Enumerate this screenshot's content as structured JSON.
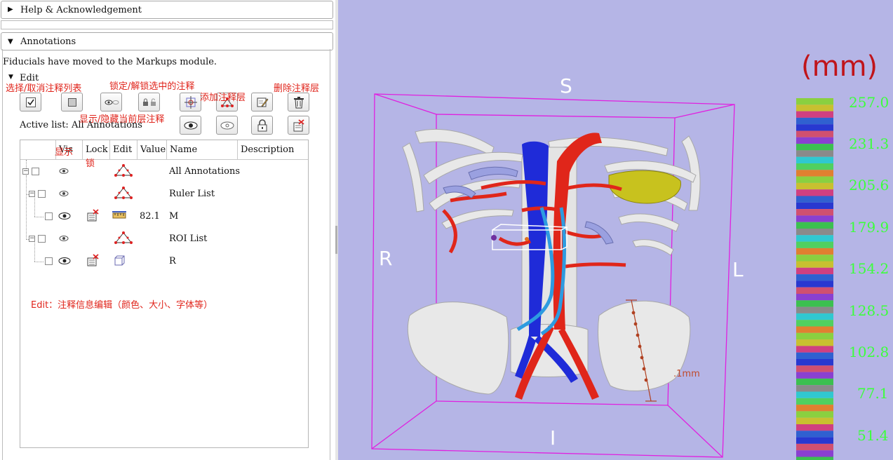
{
  "panel": {
    "help_label": "Help & Acknowledgement",
    "annotations_label": "Annotations",
    "fiducials_note": "Fiducials have moved to the Markups module.",
    "edit_label": "Edit",
    "active_list": "Active list: All Annotations"
  },
  "callouts": {
    "toggle_select": "选择/取消注释列表",
    "lock_unlock": "锁定/解锁选中的注释",
    "add_layer": "添加注释层",
    "delete_layer": "删除注释层",
    "show_hide": "显示/隐藏当前层注释",
    "vis_note": "显示",
    "lock_note": "锁",
    "edit_note": "Edit：注释信息编辑（颜色、大小、字体等）"
  },
  "tree": {
    "headers": [
      "Vis",
      "Lock",
      "Edit",
      "Value",
      "Name",
      "Description"
    ],
    "rows": [
      {
        "name": "All Annotations",
        "value": "",
        "type": "hierarchy"
      },
      {
        "name": "Ruler List",
        "value": "",
        "type": "hierarchy"
      },
      {
        "name": "M",
        "value": "82.1",
        "type": "ruler"
      },
      {
        "name": "ROI List",
        "value": "",
        "type": "hierarchy"
      },
      {
        "name": "R",
        "value": "",
        "type": "roi"
      }
    ]
  },
  "view3d": {
    "axis_s": "S",
    "axis_i": "I",
    "axis_r": "R",
    "axis_l": "L",
    "unit": "(mm)",
    "ruler_label": ".1mm",
    "scale_values": [
      "257.0",
      "231.3",
      "205.6",
      "179.9",
      "154.2",
      "128.5",
      "102.8",
      "77.1",
      "51.4"
    ],
    "background_color": "#b5b5e6",
    "box_color": "#e020e0",
    "vessel_colors": {
      "artery": "#e0261a",
      "vein": "#1f2bd8",
      "ureter": "#2d9be0",
      "bone": "#e8e8e8",
      "spleen": "#c8c21e"
    }
  }
}
